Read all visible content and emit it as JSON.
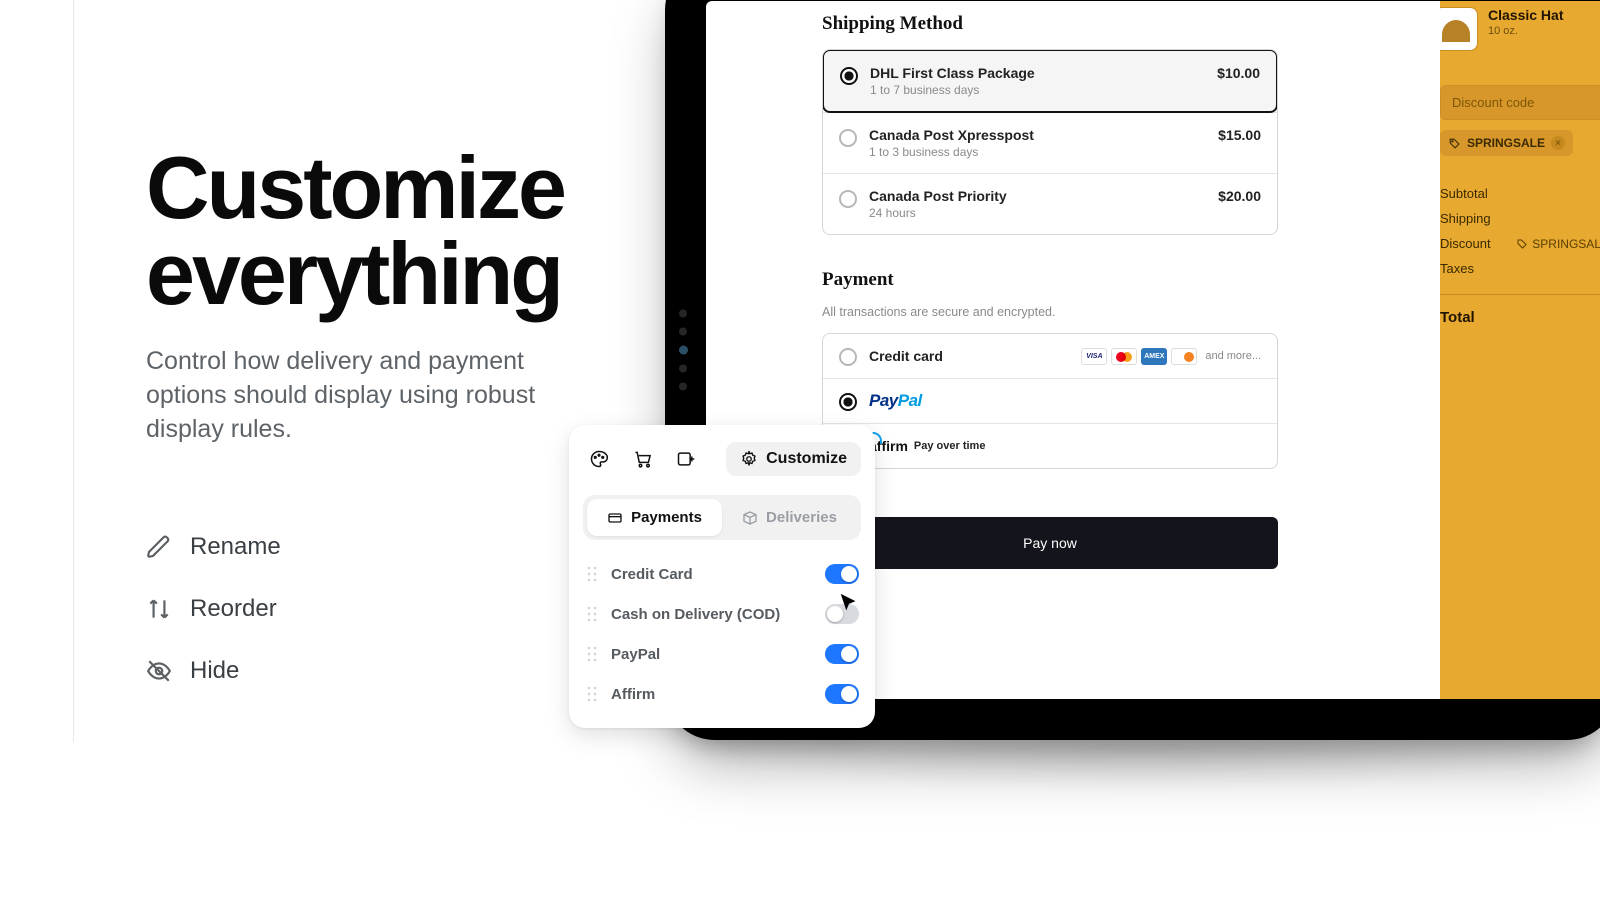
{
  "hero": {
    "title_line1": "Customize",
    "title_line2": "everything",
    "subtitle": "Control how delivery and payment options should display using robust display rules.",
    "features": {
      "rename": "Rename",
      "reorder": "Reorder",
      "hide": "Hide"
    }
  },
  "checkout": {
    "shipping": {
      "title": "Shipping Method",
      "options": [
        {
          "name": "DHL First Class Package",
          "desc": "1 to 7 business days",
          "price": "$10.00",
          "selected": true
        },
        {
          "name": "Canada Post Xpresspost",
          "desc": "1 to 3 business days",
          "price": "$15.00",
          "selected": false
        },
        {
          "name": "Canada Post Priority",
          "desc": "24 hours",
          "price": "$20.00",
          "selected": false
        }
      ]
    },
    "payment": {
      "title": "Payment",
      "note": "All transactions are secure and encrypted.",
      "and_more": "and more...",
      "options": {
        "credit": "Credit card",
        "paypal_1": "Pay",
        "paypal_2": "Pal",
        "affirm_logo": "affirm",
        "affirm_sub": "Pay over time"
      }
    },
    "pay_now": "Pay now"
  },
  "cart": {
    "product": {
      "name": "Classic Hat",
      "size": "10 oz."
    },
    "discount_placeholder": "Discount code",
    "applied_code": "SPRINGSALE",
    "totals": {
      "subtotal": "Subtotal",
      "shipping": "Shipping",
      "discount": "Discount",
      "discount_tag": "SPRINGSALE",
      "taxes": "Taxes",
      "total": "Total"
    }
  },
  "panel": {
    "customize": "Customize",
    "tabs": {
      "payments": "Payments",
      "deliveries": "Deliveries"
    },
    "methods": [
      {
        "label": "Credit Card",
        "on": true
      },
      {
        "label": "Cash on Delivery (COD)",
        "on": false
      },
      {
        "label": "PayPal",
        "on": true
      },
      {
        "label": "Affirm",
        "on": true
      }
    ]
  },
  "colors": {
    "accent": "#e7a92f",
    "toggle_on": "#1d77ff"
  }
}
